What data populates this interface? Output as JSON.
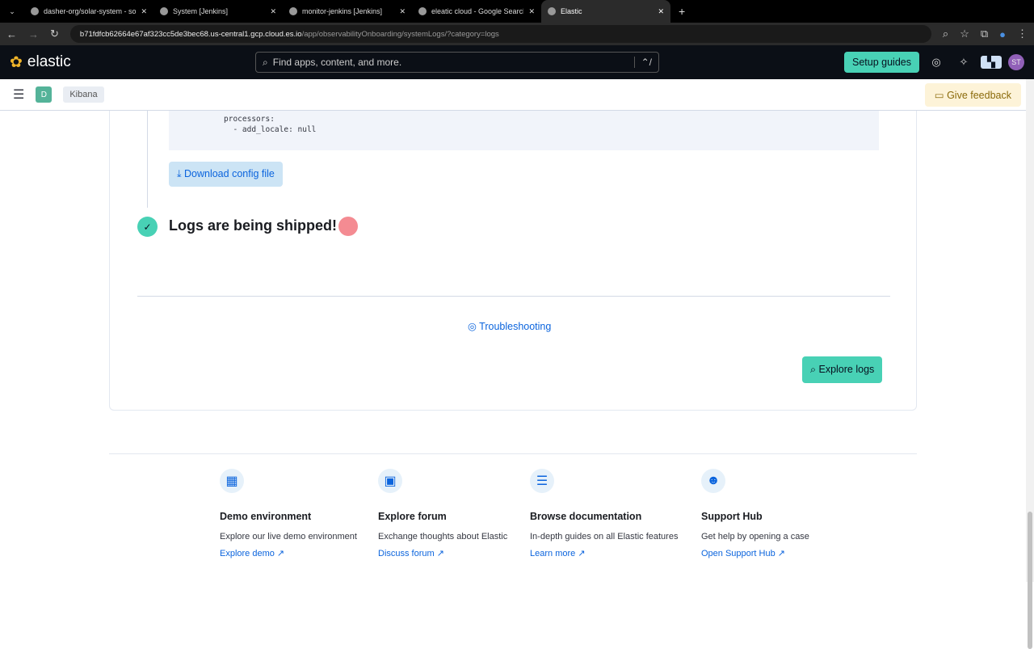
{
  "browser": {
    "tabs": [
      {
        "title": "dasher-org/solar-system - sola"
      },
      {
        "title": "System [Jenkins]"
      },
      {
        "title": "monitor-jenkins [Jenkins]"
      },
      {
        "title": "eleatic cloud - Google Search"
      },
      {
        "title": "Elastic",
        "active": true
      }
    ],
    "url_host": "b71fdfcb62664e67af323cc5de3bec68.us-central1.gcp.cloud.es.io",
    "url_path": "/app/observabilityOnboarding/systemLogs/?category=logs"
  },
  "header": {
    "logo": "elastic",
    "search_placeholder": "Find apps, content, and more.",
    "shortcut": "⌃/",
    "setup_guides": "Setup guides",
    "avatar": "ST"
  },
  "subheader": {
    "space": "D",
    "breadcrumb": "Kibana",
    "feedback": "Give feedback"
  },
  "main": {
    "code": "processors:\n  - add_locale: null",
    "download": "Download config file",
    "status": "Logs are being shipped!",
    "troubleshooting": "Troubleshooting",
    "explore_logs": "Explore logs"
  },
  "footer": [
    {
      "title": "Demo environment",
      "desc": "Explore our live demo environment",
      "link": "Explore demo"
    },
    {
      "title": "Explore forum",
      "desc": "Exchange thoughts about Elastic",
      "link": "Discuss forum"
    },
    {
      "title": "Browse documentation",
      "desc": "In-depth guides on all Elastic features",
      "link": "Learn more"
    },
    {
      "title": "Support Hub",
      "desc": "Get help by opening a case",
      "link": "Open Support Hub"
    }
  ]
}
